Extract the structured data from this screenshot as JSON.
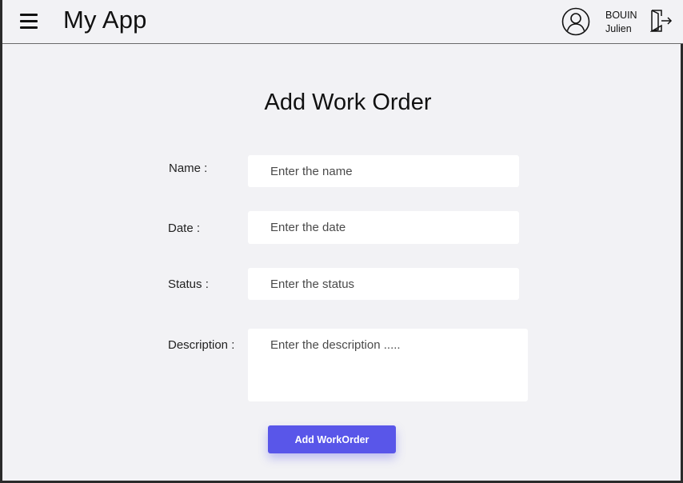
{
  "header": {
    "app_title": "My App",
    "user": {
      "last_name": "BOUIN",
      "first_name": "Julien"
    }
  },
  "form": {
    "title": "Add Work Order",
    "name": {
      "label": "Name :",
      "placeholder": "Enter the name"
    },
    "date": {
      "label": "Date :",
      "placeholder": "Enter the date"
    },
    "status": {
      "label": "Status :",
      "placeholder": "Enter the status"
    },
    "description": {
      "label": "Description :",
      "placeholder": "Enter the description ....."
    },
    "submit_label": "Add WorkOrder"
  },
  "icons": {
    "menu": "hamburger-menu-icon",
    "user": "user-avatar-icon",
    "logout": "logout-icon"
  },
  "colors": {
    "background": "#f2f2f5",
    "accent": "#5956e9",
    "input_background": "#ffffff"
  }
}
